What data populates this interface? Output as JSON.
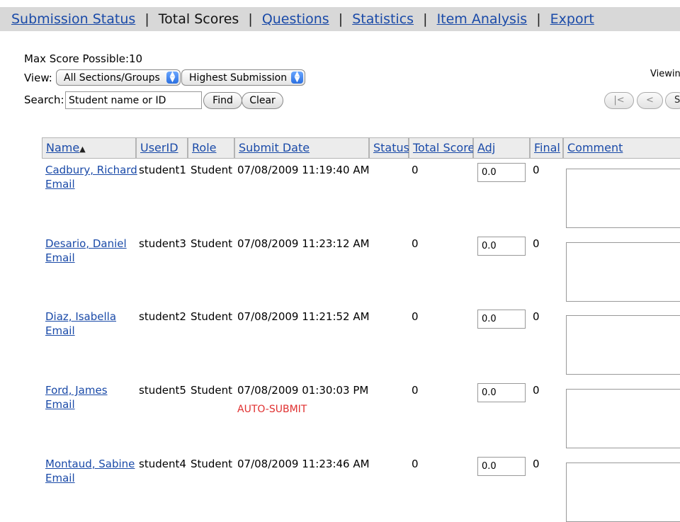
{
  "nav": {
    "items": [
      {
        "label": "Submission Status",
        "link": true
      },
      {
        "label": "Total Scores",
        "link": false
      },
      {
        "label": "Questions",
        "link": true
      },
      {
        "label": "Statistics",
        "link": true
      },
      {
        "label": "Item Analysis",
        "link": true
      },
      {
        "label": "Export",
        "link": true
      }
    ],
    "separator": "|"
  },
  "controls": {
    "max_score": "Max Score Possible:10",
    "view_label": "View:",
    "section_select": "All Sections/Groups",
    "submission_select": "Highest Submission",
    "search_label": "Search:",
    "search_value": "Student name or ID",
    "find": "Find",
    "clear": "Clear",
    "viewing": "Viewin",
    "pager": {
      "first": "|<",
      "prev": "<",
      "size": "Sl"
    }
  },
  "table": {
    "headers": {
      "name": "Name",
      "userid": "UserID",
      "role": "Role",
      "submit_date": "Submit Date",
      "status": "Status",
      "total_score": "Total Score",
      "adj": "Adj",
      "final": "Final",
      "comment": "Comment"
    },
    "email_label": "Email",
    "rows": [
      {
        "name": "Cadbury, Richard",
        "userid": "student1",
        "role": "Student",
        "date": "07/08/2009 11:19:40 AM",
        "note": "",
        "total": "0",
        "adj": "0.0",
        "final": "0"
      },
      {
        "name": "Desario, Daniel",
        "userid": "student3",
        "role": "Student",
        "date": "07/08/2009 11:23:12 AM",
        "note": "",
        "total": "0",
        "adj": "0.0",
        "final": "0"
      },
      {
        "name": "Diaz, Isabella",
        "userid": "student2",
        "role": "Student",
        "date": "07/08/2009 11:21:52 AM",
        "note": "",
        "total": "0",
        "adj": "0.0",
        "final": "0"
      },
      {
        "name": "Ford, James",
        "userid": "student5",
        "role": "Student",
        "date": "07/08/2009 01:30:03 PM",
        "note": "AUTO-SUBMIT",
        "total": "0",
        "adj": "0.0",
        "final": "0"
      },
      {
        "name": "Montaud, Sabine",
        "userid": "student4",
        "role": "Student",
        "date": "07/08/2009 11:23:46 AM",
        "note": "",
        "total": "0",
        "adj": "0.0",
        "final": "0"
      }
    ]
  },
  "colors": {
    "link": "#1a4aa8",
    "auto_submit": "#e03030",
    "header_bg": "#ececec",
    "nav_bg": "#d8d8d8"
  }
}
